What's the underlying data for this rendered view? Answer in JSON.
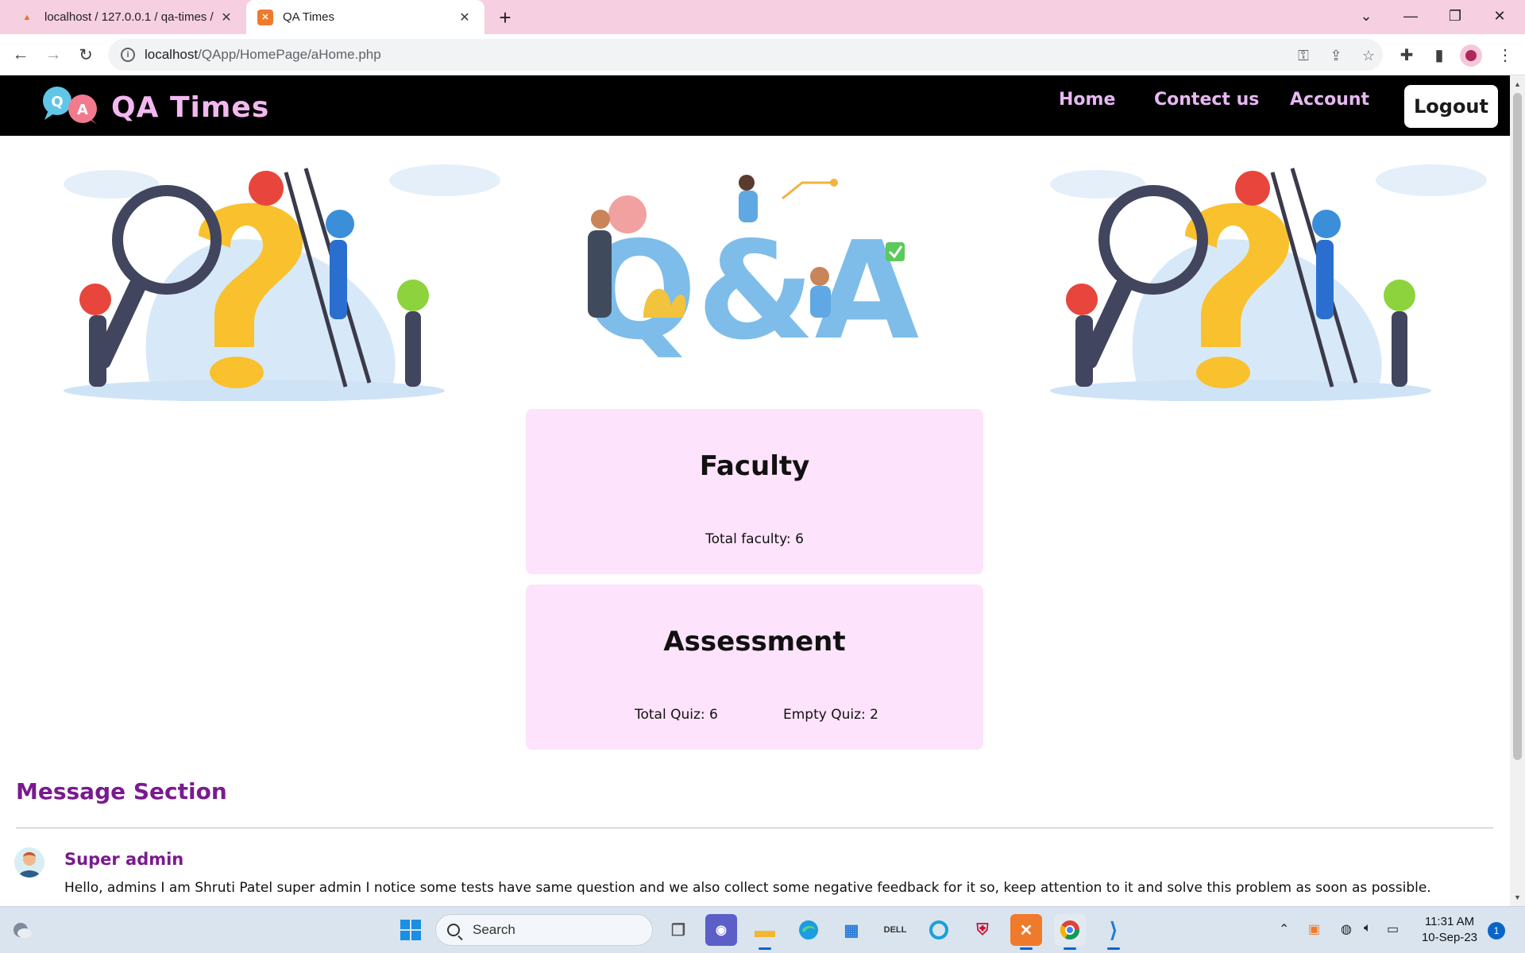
{
  "browser": {
    "tabs": [
      {
        "title": "localhost / 127.0.0.1 / qa-times /",
        "favicon": "phpmyadmin-icon"
      },
      {
        "title": "QA Times",
        "favicon": "xampp-icon"
      }
    ],
    "url_host": "localhost",
    "url_path": "/QApp/HomePage/aHome.php"
  },
  "site": {
    "logo_text": "QA Times",
    "nav": {
      "home": "Home",
      "contact": "Contect us",
      "account": "Account",
      "logout": "Logout"
    },
    "brand_color": "#f3b8f0",
    "nav_color": "#e7b8f2"
  },
  "cards": {
    "faculty": {
      "title": "Faculty",
      "total": "Total faculty: 6"
    },
    "assessment": {
      "title": "Assessment",
      "total_quiz": "Total Quiz: 6",
      "empty_quiz": "Empty Quiz: 2"
    },
    "card_bg": "#fde3fb"
  },
  "messages": {
    "section_title": "Message Section",
    "items": [
      {
        "author": "Super admin",
        "text": "Hello, admins I am Shruti Patel super admin I notice some tests have same question and we also collect some negative feedback for it so, keep attention to it and solve this problem as soon as possible."
      }
    ],
    "accent_color": "#7a1a8f"
  },
  "taskbar": {
    "search_label": "Search",
    "time": "11:31 AM",
    "date": "10-Sep-23",
    "notification_count": "1"
  }
}
